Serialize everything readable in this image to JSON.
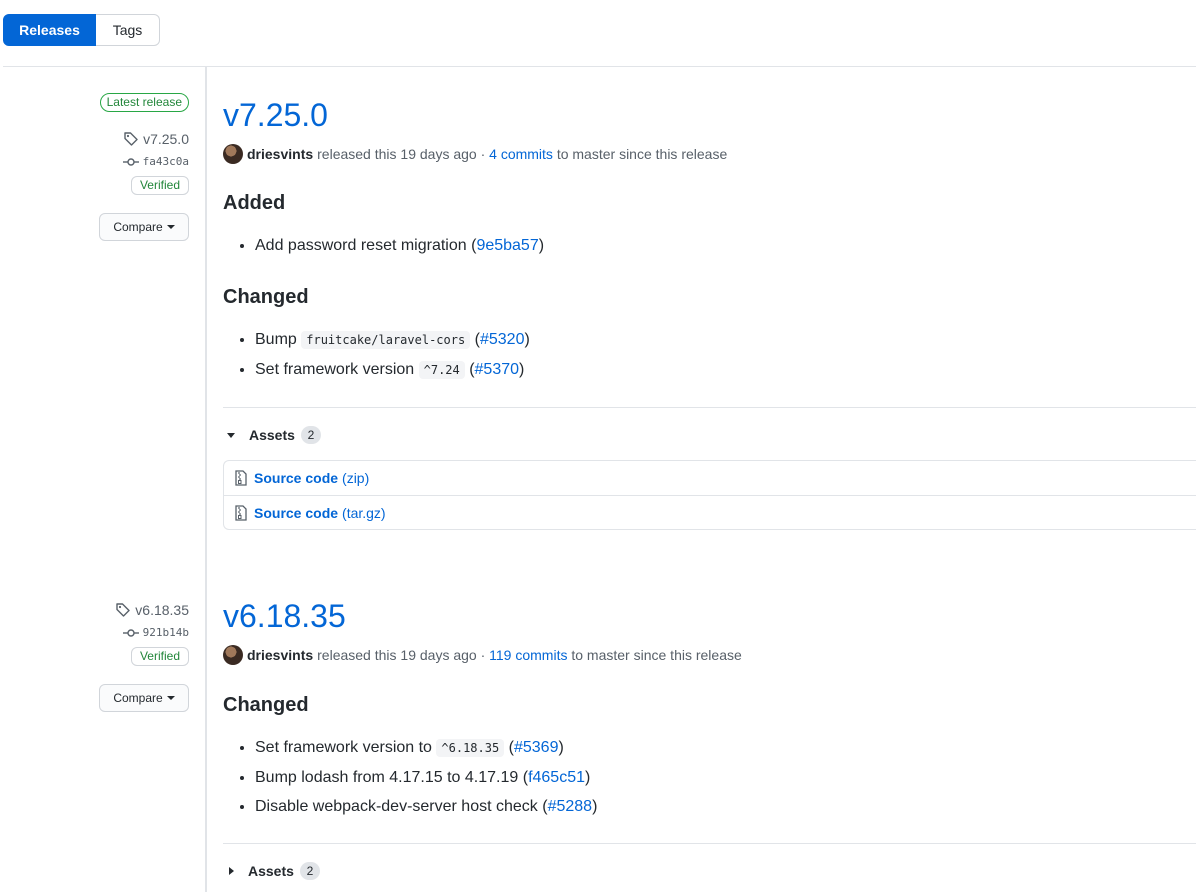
{
  "tabs": {
    "releases": "Releases",
    "tags": "Tags"
  },
  "releases": [
    {
      "latest_label": "Latest release",
      "tag": "v7.25.0",
      "commit": "fa43c0a",
      "verified": "Verified",
      "compare": "Compare",
      "title": "v7.25.0",
      "author": "driesvints",
      "released_text": "released this 19 days ago ·",
      "commits_link": "4 commits",
      "since_text": "to master since this release",
      "sections": [
        {
          "heading": "Added"
        },
        {
          "heading": "Changed"
        }
      ],
      "added_item": {
        "text": "Add password reset migration (",
        "link": "9e5ba57",
        "close": ")"
      },
      "changed_items": [
        {
          "pre": "Bump",
          "code": "fruitcake/laravel-cors",
          "open": "(",
          "link": "#5320",
          "close": ")"
        },
        {
          "pre": "Set framework version",
          "code": "^7.24",
          "open": "(",
          "link": "#5370",
          "close": ")"
        }
      ],
      "assets_label": "Assets",
      "assets_count": "2",
      "assets": [
        {
          "name": "Source code",
          "ext": "(zip)"
        },
        {
          "name": "Source code",
          "ext": "(tar.gz)"
        }
      ]
    },
    {
      "tag": "v6.18.35",
      "commit": "921b14b",
      "verified": "Verified",
      "compare": "Compare",
      "title": "v6.18.35",
      "author": "driesvints",
      "released_text": "released this 19 days ago ·",
      "commits_link": "119 commits",
      "since_text": "to master since this release",
      "section_heading": "Changed",
      "items": [
        {
          "pre": "Set framework version to",
          "code": "^6.18.35",
          "open": "(",
          "link": "#5369",
          "close": ")"
        },
        {
          "pre": "Bump lodash from 4.17.15 to 4.17.19 (",
          "link": "f465c51",
          "close": ")"
        },
        {
          "pre": "Disable webpack-dev-server host check (",
          "link": "#5288",
          "close": ")"
        }
      ],
      "assets_label": "Assets",
      "assets_count": "2"
    }
  ]
}
